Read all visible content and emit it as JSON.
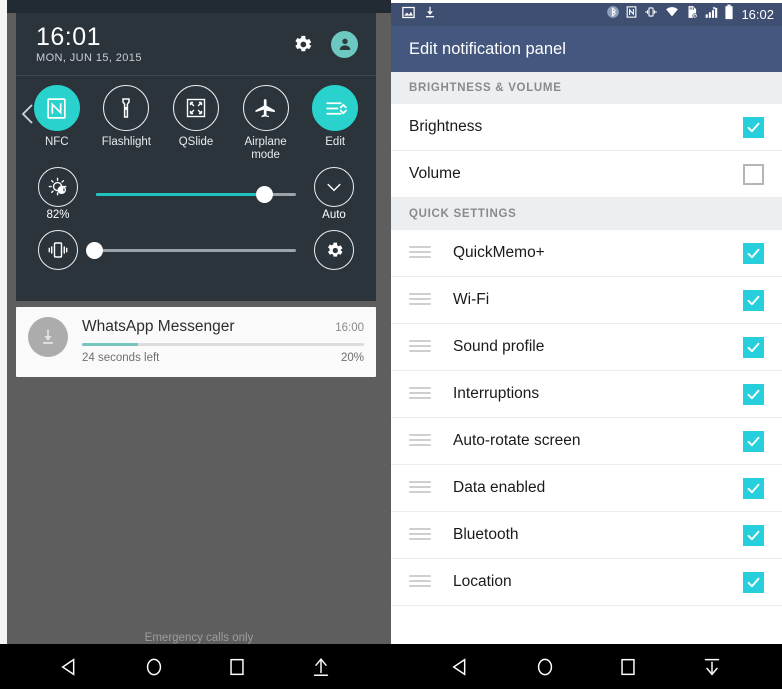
{
  "left_phone": {
    "quick_settings_panel": {
      "time": "16:01",
      "date": "MON, JUN 15, 2015",
      "settings_icon": "gear-icon",
      "user_icon": "user-avatar-icon",
      "collapse_arrow_icon": "chevron-left-icon",
      "toggles": [
        {
          "label": "NFC",
          "icon": "nfc-icon",
          "active": true
        },
        {
          "label": "Flashlight",
          "icon": "flashlight-icon",
          "active": false
        },
        {
          "label": "QSlide",
          "icon": "qslide-icon",
          "active": false
        },
        {
          "label": "Airplane mode",
          "icon": "airplane-icon",
          "active": false
        },
        {
          "label": "Edit",
          "icon": "edit-list-icon",
          "active": true
        }
      ],
      "brightness_slider": {
        "icon": "brightness-icon",
        "value_label": "82%",
        "percent": 82,
        "auto_label": "Auto",
        "auto_icon": "check-circle-icon"
      },
      "volume_slider": {
        "icon": "vibrate-icon",
        "percent": 3,
        "settings_icon": "gear-circle-icon"
      }
    },
    "notification": {
      "icon": "download-icon",
      "app_name": "WhatsApp Messenger",
      "time": "16:00",
      "status_text": "24 seconds left",
      "progress_label": "20%",
      "progress_percent": 20
    },
    "carrier_status": "Emergency calls only",
    "nav_bar": [
      {
        "name": "back-button",
        "icon": "triangle-left-icon"
      },
      {
        "name": "home-button",
        "icon": "circle-icon"
      },
      {
        "name": "recents-button",
        "icon": "square-icon"
      },
      {
        "name": "notification-expand-button",
        "icon": "arrow-up-icon"
      }
    ]
  },
  "right_phone": {
    "status_bar": {
      "left_icons": [
        "image-icon",
        "download-icon"
      ],
      "right_icons": [
        "bluetooth-icon",
        "nfc-icon",
        "vibrate-icon",
        "wifi-icon",
        "sdcard-off-icon",
        "signal-bars-icon",
        "battery-icon"
      ],
      "time": "16:02"
    },
    "app_bar": {
      "title": "Edit notification panel"
    },
    "sections": [
      {
        "header": "BRIGHTNESS & VOLUME",
        "items": [
          {
            "label": "Brightness",
            "checked": true,
            "draggable": false
          },
          {
            "label": "Volume",
            "checked": false,
            "draggable": false
          }
        ]
      },
      {
        "header": "QUICK SETTINGS",
        "items": [
          {
            "label": "QuickMemo+",
            "checked": true,
            "draggable": true
          },
          {
            "label": "Wi-Fi",
            "checked": true,
            "draggable": true
          },
          {
            "label": "Sound profile",
            "checked": true,
            "draggable": true
          },
          {
            "label": "Interruptions",
            "checked": true,
            "draggable": true
          },
          {
            "label": "Auto-rotate screen",
            "checked": true,
            "draggable": true
          },
          {
            "label": "Data enabled",
            "checked": true,
            "draggable": true
          },
          {
            "label": "Bluetooth",
            "checked": true,
            "draggable": true
          },
          {
            "label": "Location",
            "checked": true,
            "draggable": true
          }
        ]
      }
    ],
    "nav_bar": [
      {
        "name": "back-button",
        "icon": "triangle-left-icon"
      },
      {
        "name": "home-button",
        "icon": "circle-icon"
      },
      {
        "name": "recents-button",
        "icon": "square-icon"
      },
      {
        "name": "notification-collapse-button",
        "icon": "arrow-down-icon"
      }
    ]
  },
  "colors": {
    "accent_teal": "#2ad2cd",
    "checkbox_teal": "#27cfdc",
    "panel_dark": "#2b333b",
    "appbar_blue": "#44577f",
    "statusbar_blue": "#3f4f72",
    "backdrop_gray": "#5e5e5e"
  }
}
